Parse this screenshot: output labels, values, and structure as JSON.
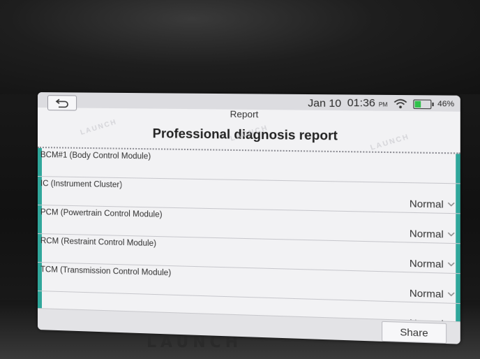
{
  "status_bar": {
    "date": "Jan 10",
    "time": "01:36",
    "ampm": "PM",
    "battery_pct": "46%",
    "battery_level": 0.46,
    "wifi_icon": "wifi-icon",
    "battery_icon": "battery-icon"
  },
  "header": {
    "back_icon": "back-arrow-icon",
    "title": "Report"
  },
  "report": {
    "heading": "Professional diagnosis report",
    "rows": [
      {
        "name": "BCM#1 (Body Control Module)",
        "status": ""
      },
      {
        "name": "IC (Instrument Cluster)",
        "status": "Normal"
      },
      {
        "name": "PCM (Powertrain Control Module)",
        "status": "Normal"
      },
      {
        "name": "RCM (Restraint Control Module)",
        "status": "Normal"
      },
      {
        "name": "TCM (Transmission Control Module)",
        "status": "Normal"
      },
      {
        "name": "",
        "status": "Normal"
      }
    ]
  },
  "footer": {
    "share_label": "Share"
  },
  "colors": {
    "accent": "#30a79b",
    "battery": "#2fc14a"
  }
}
